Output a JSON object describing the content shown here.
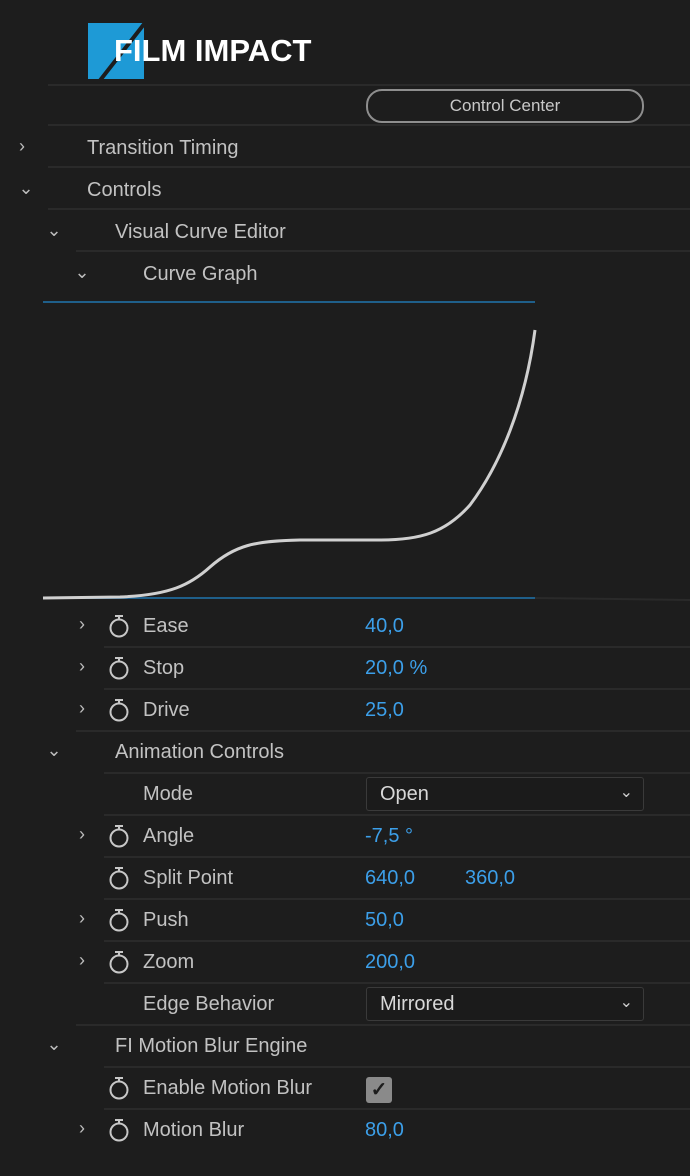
{
  "logo": {
    "text": "FILM IMPACT",
    "color": "#1e9ad6"
  },
  "control_center_label": "Control Center",
  "sections": {
    "transition_timing": "Transition Timing",
    "controls": "Controls",
    "visual_curve_editor": "Visual Curve Editor",
    "curve_graph": "Curve Graph",
    "animation_controls": "Animation Controls",
    "motion_blur_engine": "FI Motion Blur Engine"
  },
  "params": {
    "ease": {
      "label": "Ease",
      "value": "40,0"
    },
    "stop": {
      "label": "Stop",
      "value": "20,0 %"
    },
    "drive": {
      "label": "Drive",
      "value": "25,0"
    },
    "mode": {
      "label": "Mode",
      "value": "Open"
    },
    "angle": {
      "label": "Angle",
      "value": "-7,5 °"
    },
    "split_point": {
      "label": "Split Point",
      "x": "640,0",
      "y": "360,0"
    },
    "push": {
      "label": "Push",
      "value": "50,0"
    },
    "zoom": {
      "label": "Zoom",
      "value": "200,0"
    },
    "edge_behavior": {
      "label": "Edge Behavior",
      "value": "Mirrored"
    },
    "enable_motion_blur": {
      "label": "Enable Motion Blur",
      "checked": true
    },
    "motion_blur": {
      "label": "Motion Blur",
      "value": "80,0"
    }
  },
  "colors": {
    "value": "#3c9fe9",
    "graph_line": "#1f5f8a",
    "curve": "#d0d0d0"
  }
}
